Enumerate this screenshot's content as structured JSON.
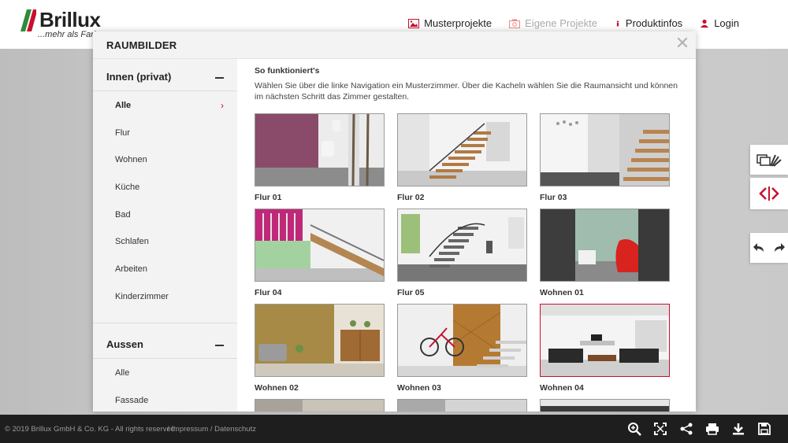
{
  "header": {
    "logo_text": "Brillux",
    "logo_tagline": "...mehr als Farbe",
    "nav": [
      {
        "label": "Musterprojekte",
        "icon": "image-icon",
        "muted": false
      },
      {
        "label": "Eigene Projekte",
        "icon": "camera-icon",
        "muted": true
      },
      {
        "label": "Produktinfos",
        "icon": "info-icon",
        "muted": false
      },
      {
        "label": "Login",
        "icon": "user-icon",
        "muted": false
      }
    ]
  },
  "modal": {
    "title": "RAUMBILDER",
    "close_symbol": "✕"
  },
  "sidebar": {
    "sections": [
      {
        "title": "Innen (privat)",
        "items": [
          "Alle",
          "Flur",
          "Wohnen",
          "Küche",
          "Bad",
          "Schlafen",
          "Arbeiten",
          "Kinderzimmer"
        ],
        "active": "Alle"
      },
      {
        "title": "Aussen",
        "items": [
          "Alle",
          "Fassade"
        ]
      }
    ]
  },
  "content": {
    "how_title": "So funktioniert's",
    "how_text": "Wählen Sie über die linke Navigation ein Musterzimmer. Über die Kacheln wählen Sie die Raumansicht und können im nächsten Schritt das Zimmer gestalten.",
    "tiles": [
      {
        "label": "Flur 01",
        "scene": "purple-hall"
      },
      {
        "label": "Flur 02",
        "scene": "white-stairs"
      },
      {
        "label": "Flur 03",
        "scene": "gray-stairs"
      },
      {
        "label": "Flur 04",
        "scene": "pink-gallery"
      },
      {
        "label": "Flur 05",
        "scene": "steel-stairs"
      },
      {
        "label": "Wohnen 01",
        "scene": "red-chair"
      },
      {
        "label": "Wohnen 02",
        "scene": "gold-wall"
      },
      {
        "label": "Wohnen 03",
        "scene": "bike-wall"
      },
      {
        "label": "Wohnen 04",
        "scene": "living-room"
      }
    ],
    "selected_tile": "Wohnen 04"
  },
  "footer": {
    "copyright": "© 2019 Brillux GmbH & Co. KG - All rights reserved.",
    "links": "/ Impressum / Datenschutz",
    "tools": [
      "zoom-icon",
      "fullscreen-icon",
      "share-icon",
      "print-icon",
      "download-icon",
      "save-icon"
    ]
  },
  "colors": {
    "brand_red": "#c8102e",
    "brand_green": "#2e8b3a",
    "footer_bg": "#1e1e1e"
  }
}
